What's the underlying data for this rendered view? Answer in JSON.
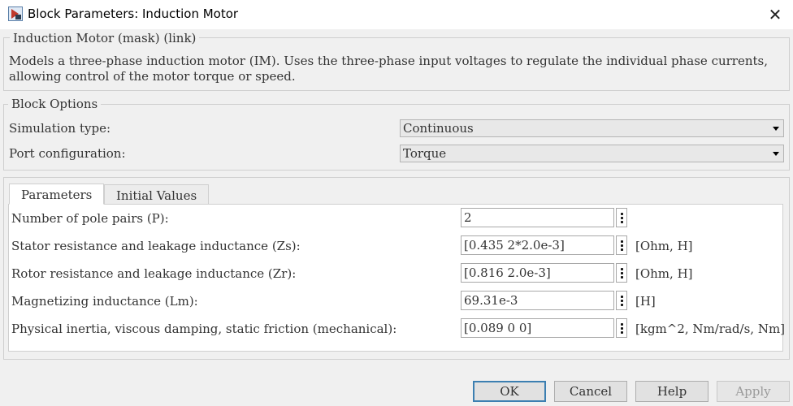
{
  "window": {
    "title": "Block Parameters: Induction Motor",
    "close_glyph": "✕"
  },
  "mask": {
    "legend": "Induction Motor (mask) (link)",
    "description": "Models a three-phase induction motor (IM). Uses the three-phase input voltages to regulate the individual phase currents, allowing control of the motor torque or speed."
  },
  "block_options": {
    "legend": "Block Options",
    "simulation_type": {
      "label": "Simulation type:",
      "value": "Continuous"
    },
    "port_configuration": {
      "label": "Port configuration:",
      "value": "Torque"
    }
  },
  "tabs": [
    {
      "label": "Parameters",
      "active": true
    },
    {
      "label": "Initial Values",
      "active": false
    }
  ],
  "parameters": [
    {
      "label": "Number of pole pairs (P):",
      "value": "2",
      "unit": ""
    },
    {
      "label": "Stator resistance and leakage inductance (Zs):",
      "value": "[0.435 2*2.0e-3]",
      "unit": "[Ohm, H]"
    },
    {
      "label": "Rotor resistance and leakage inductance (Zr):",
      "value": "[0.816  2.0e-3]",
      "unit": "[Ohm, H]"
    },
    {
      "label": "Magnetizing inductance (Lm):",
      "value": "69.31e-3",
      "unit": "[H]"
    },
    {
      "label": "Physical inertia, viscous damping, static friction (mechanical):",
      "value": "[0.089 0 0]",
      "unit": "[kgm^2, Nm/rad/s, Nm]"
    }
  ],
  "buttons": {
    "ok": "OK",
    "cancel": "Cancel",
    "help": "Help",
    "apply": "Apply"
  }
}
